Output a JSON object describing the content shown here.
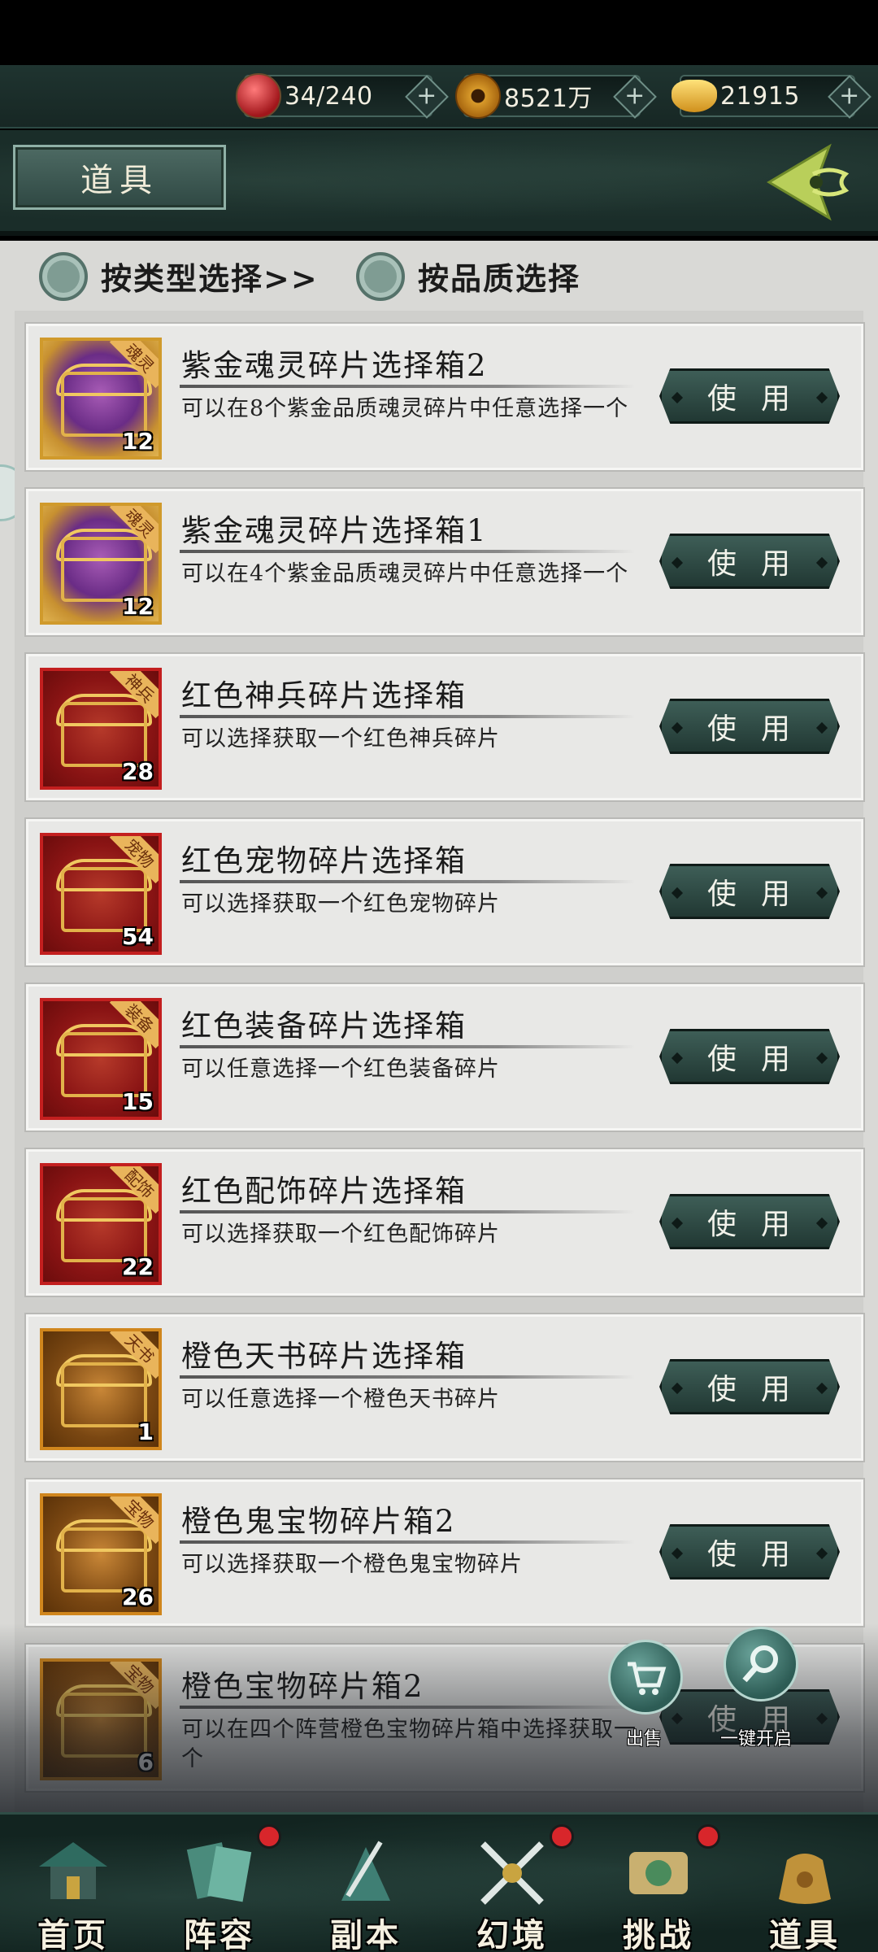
{
  "resources": [
    {
      "icon": "pill-gourd-icon",
      "value": "34/240"
    },
    {
      "icon": "copper-coin-icon",
      "value": "8521万"
    },
    {
      "icon": "gold-ingot-icon",
      "value": "21915"
    }
  ],
  "header": {
    "title": "道具"
  },
  "filters": {
    "by_type": "按类型选择>>",
    "by_quality": "按品质选择"
  },
  "items": [
    {
      "name": "紫金魂灵碎片选择箱2",
      "desc": "可以在8个紫金品质魂灵碎片中任意选择一个",
      "count": "12",
      "tag": "魂灵",
      "frame": "purple",
      "button": "使用"
    },
    {
      "name": "紫金魂灵碎片选择箱1",
      "desc": "可以在4个紫金品质魂灵碎片中任意选择一个",
      "count": "12",
      "tag": "魂灵",
      "frame": "purple",
      "button": "使用"
    },
    {
      "name": "红色神兵碎片选择箱",
      "desc": "可以选择获取一个红色神兵碎片",
      "count": "28",
      "tag": "神兵",
      "frame": "red",
      "button": "使用"
    },
    {
      "name": "红色宠物碎片选择箱",
      "desc": "可以选择获取一个红色宠物碎片",
      "count": "54",
      "tag": "宠物",
      "frame": "red",
      "button": "使用"
    },
    {
      "name": "红色装备碎片选择箱",
      "desc": "可以任意选择一个红色装备碎片",
      "count": "15",
      "tag": "装备",
      "frame": "red",
      "button": "使用"
    },
    {
      "name": "红色配饰碎片选择箱",
      "desc": "可以选择获取一个红色配饰碎片",
      "count": "22",
      "tag": "配饰",
      "frame": "red",
      "button": "使用"
    },
    {
      "name": "橙色天书碎片选择箱",
      "desc": "可以任意选择一个橙色天书碎片",
      "count": "1",
      "tag": "天书",
      "frame": "orange",
      "button": "使用"
    },
    {
      "name": "橙色鬼宝物碎片箱2",
      "desc": "可以选择获取一个橙色鬼宝物碎片",
      "count": "26",
      "tag": "宝物",
      "frame": "orange",
      "button": "使用"
    },
    {
      "name": "橙色宝物碎片箱2",
      "desc": "可以在四个阵营橙色宝物碎片箱中选择获取一个",
      "count": "6",
      "tag": "宝物",
      "frame": "orange",
      "button": "使用"
    }
  ],
  "fabs": {
    "sell": "出售",
    "open_all": "一键开启"
  },
  "nav": [
    {
      "label": "首页",
      "icon": "palace-icon",
      "badge": false
    },
    {
      "label": "阵容",
      "icon": "formation-cards-icon",
      "badge": true
    },
    {
      "label": "副本",
      "icon": "dungeon-sword-icon",
      "badge": false
    },
    {
      "label": "幻境",
      "icon": "crossed-swords-icon",
      "badge": true
    },
    {
      "label": "挑战",
      "icon": "scroll-dragon-icon",
      "badge": true
    },
    {
      "label": "道具",
      "icon": "treasure-bag-icon",
      "badge": false
    }
  ],
  "colors": {
    "accent": "#2f4843",
    "button": "#2b4641",
    "badge": "#d8262b",
    "purple_frame": "#d09a2c",
    "red_frame": "#c31f1f",
    "orange_frame": "#d0861d"
  }
}
